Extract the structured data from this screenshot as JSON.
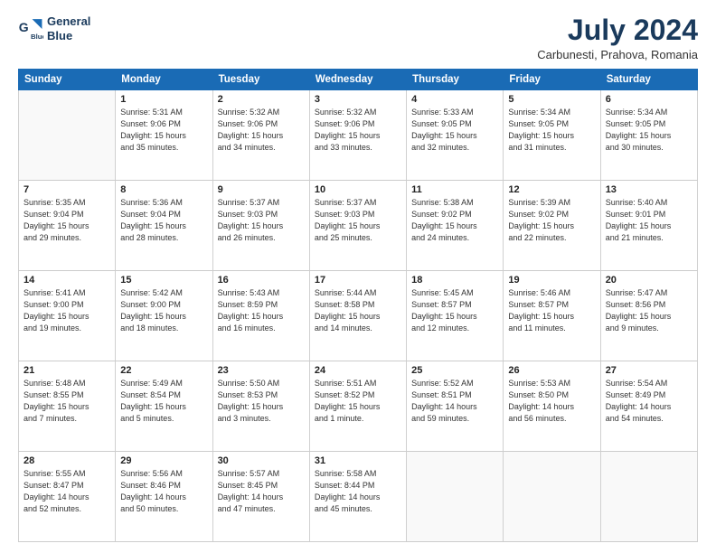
{
  "header": {
    "logo_line1": "General",
    "logo_line2": "Blue",
    "month_year": "July 2024",
    "location": "Carbunesti, Prahova, Romania"
  },
  "days_of_week": [
    "Sunday",
    "Monday",
    "Tuesday",
    "Wednesday",
    "Thursday",
    "Friday",
    "Saturday"
  ],
  "weeks": [
    [
      {
        "num": "",
        "info": ""
      },
      {
        "num": "1",
        "info": "Sunrise: 5:31 AM\nSunset: 9:06 PM\nDaylight: 15 hours\nand 35 minutes."
      },
      {
        "num": "2",
        "info": "Sunrise: 5:32 AM\nSunset: 9:06 PM\nDaylight: 15 hours\nand 34 minutes."
      },
      {
        "num": "3",
        "info": "Sunrise: 5:32 AM\nSunset: 9:06 PM\nDaylight: 15 hours\nand 33 minutes."
      },
      {
        "num": "4",
        "info": "Sunrise: 5:33 AM\nSunset: 9:05 PM\nDaylight: 15 hours\nand 32 minutes."
      },
      {
        "num": "5",
        "info": "Sunrise: 5:34 AM\nSunset: 9:05 PM\nDaylight: 15 hours\nand 31 minutes."
      },
      {
        "num": "6",
        "info": "Sunrise: 5:34 AM\nSunset: 9:05 PM\nDaylight: 15 hours\nand 30 minutes."
      }
    ],
    [
      {
        "num": "7",
        "info": "Sunrise: 5:35 AM\nSunset: 9:04 PM\nDaylight: 15 hours\nand 29 minutes."
      },
      {
        "num": "8",
        "info": "Sunrise: 5:36 AM\nSunset: 9:04 PM\nDaylight: 15 hours\nand 28 minutes."
      },
      {
        "num": "9",
        "info": "Sunrise: 5:37 AM\nSunset: 9:03 PM\nDaylight: 15 hours\nand 26 minutes."
      },
      {
        "num": "10",
        "info": "Sunrise: 5:37 AM\nSunset: 9:03 PM\nDaylight: 15 hours\nand 25 minutes."
      },
      {
        "num": "11",
        "info": "Sunrise: 5:38 AM\nSunset: 9:02 PM\nDaylight: 15 hours\nand 24 minutes."
      },
      {
        "num": "12",
        "info": "Sunrise: 5:39 AM\nSunset: 9:02 PM\nDaylight: 15 hours\nand 22 minutes."
      },
      {
        "num": "13",
        "info": "Sunrise: 5:40 AM\nSunset: 9:01 PM\nDaylight: 15 hours\nand 21 minutes."
      }
    ],
    [
      {
        "num": "14",
        "info": "Sunrise: 5:41 AM\nSunset: 9:00 PM\nDaylight: 15 hours\nand 19 minutes."
      },
      {
        "num": "15",
        "info": "Sunrise: 5:42 AM\nSunset: 9:00 PM\nDaylight: 15 hours\nand 18 minutes."
      },
      {
        "num": "16",
        "info": "Sunrise: 5:43 AM\nSunset: 8:59 PM\nDaylight: 15 hours\nand 16 minutes."
      },
      {
        "num": "17",
        "info": "Sunrise: 5:44 AM\nSunset: 8:58 PM\nDaylight: 15 hours\nand 14 minutes."
      },
      {
        "num": "18",
        "info": "Sunrise: 5:45 AM\nSunset: 8:57 PM\nDaylight: 15 hours\nand 12 minutes."
      },
      {
        "num": "19",
        "info": "Sunrise: 5:46 AM\nSunset: 8:57 PM\nDaylight: 15 hours\nand 11 minutes."
      },
      {
        "num": "20",
        "info": "Sunrise: 5:47 AM\nSunset: 8:56 PM\nDaylight: 15 hours\nand 9 minutes."
      }
    ],
    [
      {
        "num": "21",
        "info": "Sunrise: 5:48 AM\nSunset: 8:55 PM\nDaylight: 15 hours\nand 7 minutes."
      },
      {
        "num": "22",
        "info": "Sunrise: 5:49 AM\nSunset: 8:54 PM\nDaylight: 15 hours\nand 5 minutes."
      },
      {
        "num": "23",
        "info": "Sunrise: 5:50 AM\nSunset: 8:53 PM\nDaylight: 15 hours\nand 3 minutes."
      },
      {
        "num": "24",
        "info": "Sunrise: 5:51 AM\nSunset: 8:52 PM\nDaylight: 15 hours\nand 1 minute."
      },
      {
        "num": "25",
        "info": "Sunrise: 5:52 AM\nSunset: 8:51 PM\nDaylight: 14 hours\nand 59 minutes."
      },
      {
        "num": "26",
        "info": "Sunrise: 5:53 AM\nSunset: 8:50 PM\nDaylight: 14 hours\nand 56 minutes."
      },
      {
        "num": "27",
        "info": "Sunrise: 5:54 AM\nSunset: 8:49 PM\nDaylight: 14 hours\nand 54 minutes."
      }
    ],
    [
      {
        "num": "28",
        "info": "Sunrise: 5:55 AM\nSunset: 8:47 PM\nDaylight: 14 hours\nand 52 minutes."
      },
      {
        "num": "29",
        "info": "Sunrise: 5:56 AM\nSunset: 8:46 PM\nDaylight: 14 hours\nand 50 minutes."
      },
      {
        "num": "30",
        "info": "Sunrise: 5:57 AM\nSunset: 8:45 PM\nDaylight: 14 hours\nand 47 minutes."
      },
      {
        "num": "31",
        "info": "Sunrise: 5:58 AM\nSunset: 8:44 PM\nDaylight: 14 hours\nand 45 minutes."
      },
      {
        "num": "",
        "info": ""
      },
      {
        "num": "",
        "info": ""
      },
      {
        "num": "",
        "info": ""
      }
    ]
  ]
}
